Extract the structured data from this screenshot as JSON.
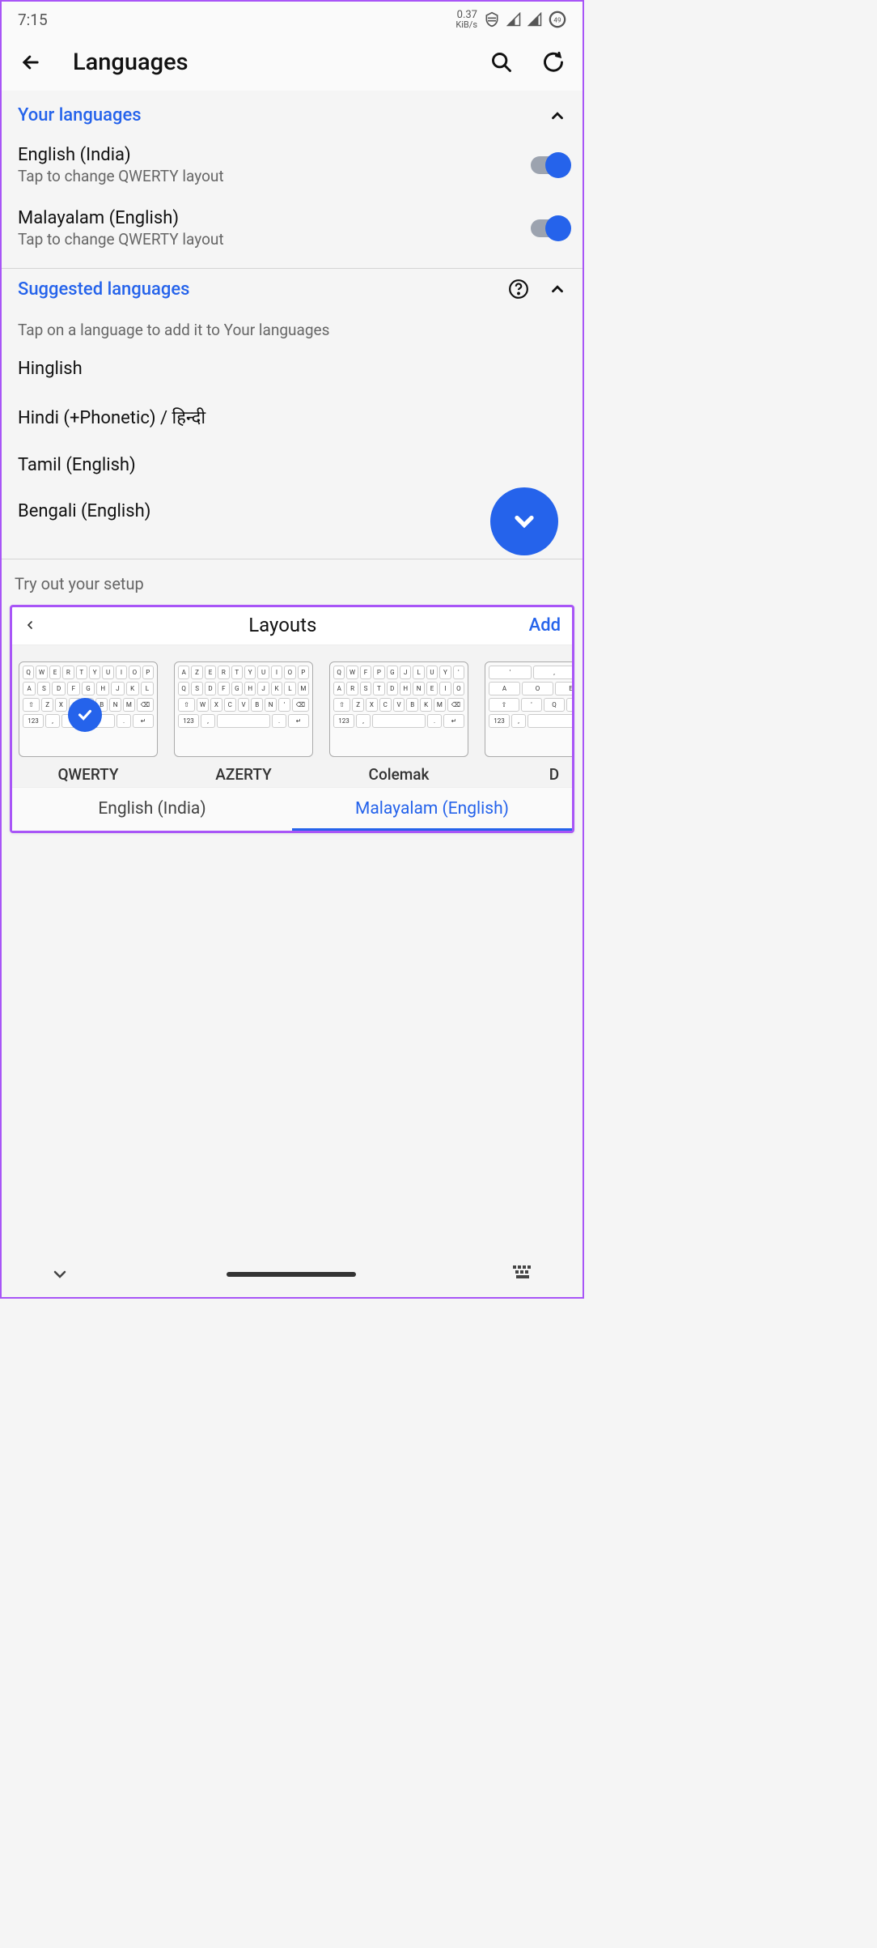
{
  "statusBar": {
    "time": "7:15",
    "dataRate": "0.37",
    "dataUnit": "KiB/s",
    "battery": "49"
  },
  "header": {
    "title": "Languages"
  },
  "yourLanguages": {
    "heading": "Your languages",
    "items": [
      {
        "title": "English (India)",
        "subtitle": "Tap to change QWERTY layout",
        "enabled": true
      },
      {
        "title": "Malayalam (English)",
        "subtitle": "Tap to change QWERTY layout",
        "enabled": true
      }
    ]
  },
  "suggestedLanguages": {
    "heading": "Suggested languages",
    "hint": "Tap on a language to add it to Your languages",
    "items": [
      "Hinglish",
      "Hindi (+Phonetic) / हिन्दी",
      "Tamil (English)",
      "Bengali (English)"
    ]
  },
  "tryout": {
    "label": "Try out your setup"
  },
  "layoutPanel": {
    "title": "Layouts",
    "addLabel": "Add",
    "layouts": [
      {
        "name": "QWERTY",
        "selected": true,
        "rows": [
          "QWERTYUIOP",
          "ASDFGHJKL",
          "ZXCVBNM"
        ]
      },
      {
        "name": "AZERTY",
        "selected": false,
        "rows": [
          "AZERTYUIOP",
          "QSDFGHJKLM",
          "WXCVBN'"
        ]
      },
      {
        "name": "Colemak",
        "selected": false,
        "rows": [
          "QWFPGJLUY'",
          "ARSTDHNEIO",
          "ZXCVBKM"
        ]
      },
      {
        "name": "D",
        "selected": false,
        "rows": [
          "',.",
          "AOEU",
          "'QJ"
        ]
      }
    ],
    "tabs": [
      {
        "label": "English (India)",
        "active": false
      },
      {
        "label": "Malayalam (English)",
        "active": true
      }
    ]
  }
}
